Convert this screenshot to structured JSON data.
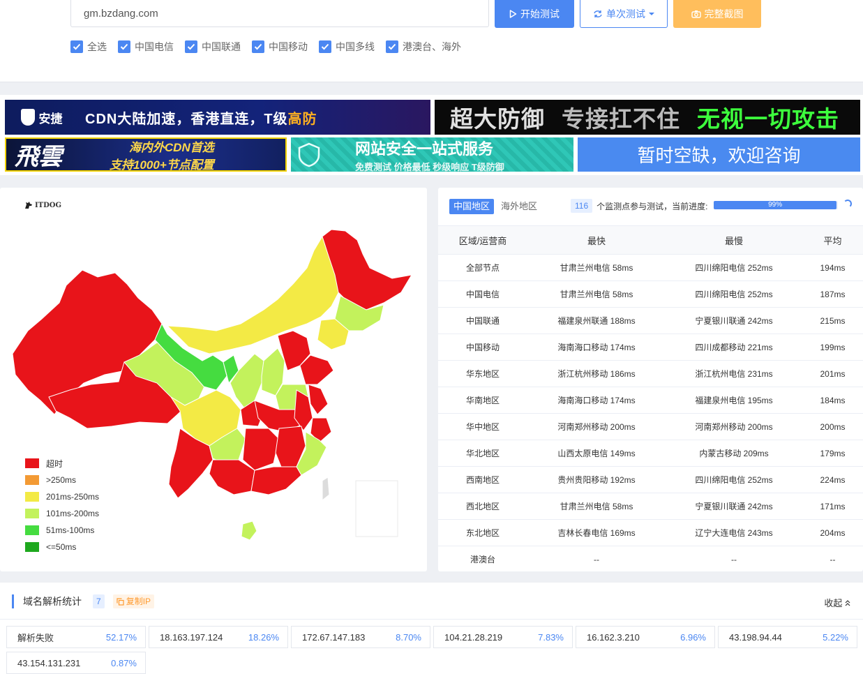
{
  "search": {
    "value": "gm.bzdang.com"
  },
  "buttons": {
    "start": "开始测试",
    "single": "单次测试",
    "screenshot": "完整截图"
  },
  "checkboxes": [
    "全选",
    "中国电信",
    "中国联通",
    "中国移动",
    "中国多线",
    "港澳台、海外"
  ],
  "ads": {
    "ad1": {
      "logo": "安捷",
      "text_main": "CDN大陆加速，香港直连，T级",
      "text_accent": "高防"
    },
    "ad2": {
      "t1": "超大防御",
      "t2": "专接扛不住",
      "t3": "无视一切攻击"
    },
    "ad3": {
      "big": "飛雲",
      "line1": "海内外CDN首选",
      "line2": "支持1000+节点配置"
    },
    "ad4": {
      "line1": "网站安全一站式服务",
      "line2": "免费测试 价格最低 秒级响应 T级防御"
    },
    "ad5": {
      "text": "暂时空缺，欢迎咨询"
    }
  },
  "map": {
    "brand": "ITDOG",
    "legend": [
      {
        "label": "超时",
        "color": "#e8141a"
      },
      {
        "label": ">250ms",
        "color": "#f39a34"
      },
      {
        "label": "201ms-250ms",
        "color": "#f3ea45"
      },
      {
        "label": "101ms-200ms",
        "color": "#c3f25c"
      },
      {
        "label": "51ms-100ms",
        "color": "#45dc40"
      },
      {
        "label": "<=50ms",
        "color": "#1ea81e"
      }
    ]
  },
  "stats": {
    "tabs": [
      "中国地区",
      "海外地区"
    ],
    "node_count": "116",
    "count_text": "个监测点参与测试，当前进度:",
    "progress_label": "99%",
    "progress_value": 0.99,
    "headers": [
      "区域/运营商",
      "最快",
      "最慢",
      "平均"
    ],
    "rows": [
      [
        "全部节点",
        "甘肃兰州电信 58ms",
        "四川绵阳电信 252ms",
        "194ms"
      ],
      [
        "中国电信",
        "甘肃兰州电信 58ms",
        "四川绵阳电信 252ms",
        "187ms"
      ],
      [
        "中国联通",
        "福建泉州联通 188ms",
        "宁夏银川联通 242ms",
        "215ms"
      ],
      [
        "中国移动",
        "海南海口移动 174ms",
        "四川成都移动 221ms",
        "199ms"
      ],
      [
        "华东地区",
        "浙江杭州移动 186ms",
        "浙江杭州电信 231ms",
        "201ms"
      ],
      [
        "华南地区",
        "海南海口移动 174ms",
        "福建泉州电信 195ms",
        "184ms"
      ],
      [
        "华中地区",
        "河南郑州移动 200ms",
        "河南郑州移动 200ms",
        "200ms"
      ],
      [
        "华北地区",
        "山西太原电信 149ms",
        "内蒙古移动 209ms",
        "179ms"
      ],
      [
        "西南地区",
        "贵州贵阳移动 192ms",
        "四川绵阳电信 252ms",
        "224ms"
      ],
      [
        "西北地区",
        "甘肃兰州电信 58ms",
        "宁夏银川联通 242ms",
        "171ms"
      ],
      [
        "东北地区",
        "吉林长春电信 169ms",
        "辽宁大连电信 243ms",
        "204ms"
      ],
      [
        "港澳台",
        "--",
        "--",
        "--"
      ]
    ]
  },
  "dns": {
    "title": "域名解析统计",
    "count": "7",
    "copy_label": "复制IP",
    "collapse_label": "收起",
    "entries": [
      {
        "ip": "解析失败",
        "pct": "52.17%"
      },
      {
        "ip": "18.163.197.124",
        "pct": "18.26%"
      },
      {
        "ip": "172.67.147.183",
        "pct": "8.70%"
      },
      {
        "ip": "104.21.28.219",
        "pct": "7.83%"
      },
      {
        "ip": "16.162.3.210",
        "pct": "6.96%"
      },
      {
        "ip": "43.198.94.44",
        "pct": "5.22%"
      },
      {
        "ip": "43.154.131.231",
        "pct": "0.87%"
      }
    ]
  }
}
